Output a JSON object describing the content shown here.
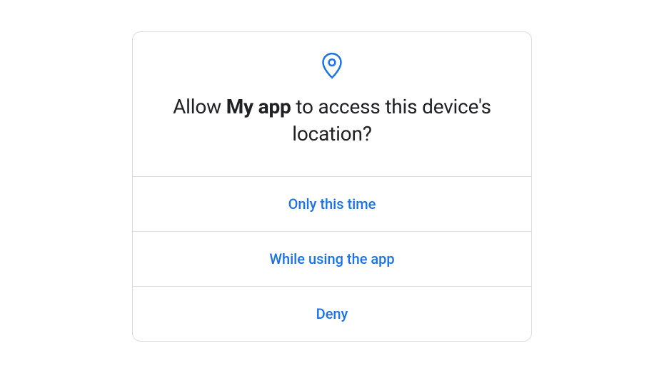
{
  "dialog": {
    "icon_color": "#1a73e8",
    "title_prefix": "Allow ",
    "app_name": "My app",
    "title_suffix": " to access this device's location?",
    "buttons": {
      "only_this_time": "Only this time",
      "while_using": "While using the app",
      "deny": "Deny"
    }
  }
}
